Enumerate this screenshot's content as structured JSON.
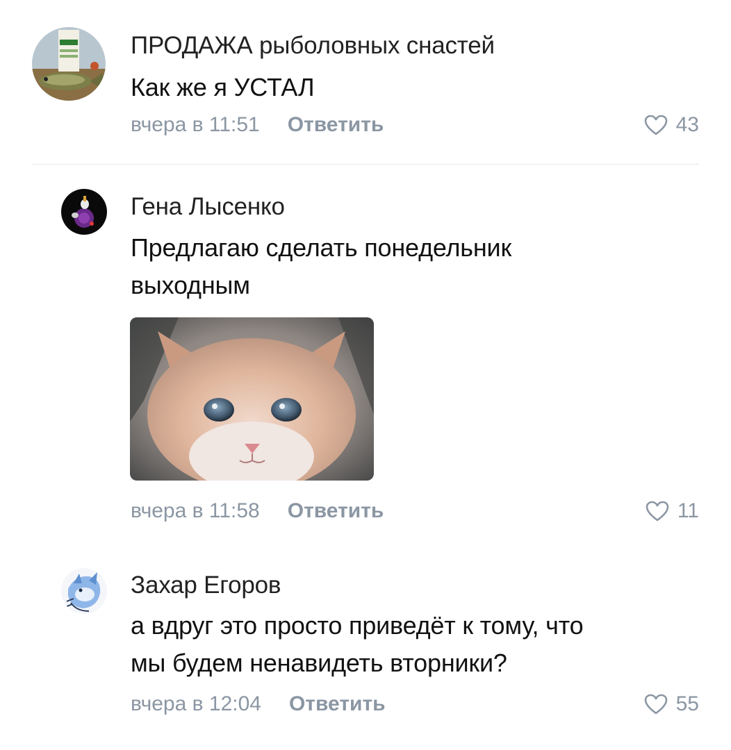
{
  "comments": [
    {
      "author": "ПРОДАЖА рыболовных снастей",
      "text_lines": [
        "Как же я УСТАЛ"
      ],
      "time": "вчера в 11:51",
      "reply_label": "Ответить",
      "likes": "43"
    },
    {
      "author": "Гена Лысенко",
      "text_lines": [
        "Предлагаю сделать понедельник",
        "выходным"
      ],
      "time": "вчера в 11:58",
      "reply_label": "Ответить",
      "likes": "11",
      "attachment": "kitten-photo"
    },
    {
      "author": "Захар Егоров",
      "text_lines": [
        "а вдруг это просто приведёт к тому, что",
        "мы будем ненавидеть вторники?"
      ],
      "time": "вчера в 12:04",
      "reply_label": "Ответить",
      "likes": "55"
    }
  ],
  "colors": {
    "meta_gray": "#8b96a3",
    "divider": "#e5e8ec",
    "text": "#111111"
  },
  "icons": {
    "like": "heart-outline-icon"
  }
}
